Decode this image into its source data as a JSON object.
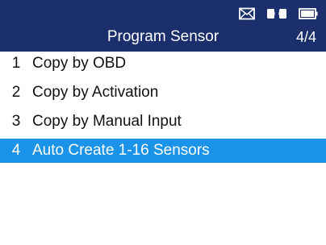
{
  "header": {
    "title": "Program Sensor",
    "page_indicator": "4/4",
    "status_icons": [
      "mail-icon",
      "vci-connection-icon",
      "battery-icon"
    ]
  },
  "menu": {
    "items": [
      {
        "number": "1",
        "label": "Copy by OBD",
        "selected": false
      },
      {
        "number": "2",
        "label": "Copy by Activation",
        "selected": false
      },
      {
        "number": "3",
        "label": "Copy by Manual Input",
        "selected": false
      },
      {
        "number": "4",
        "label": "Auto Create 1-16 Sensors",
        "selected": true
      }
    ]
  },
  "colors": {
    "header_bg": "#1a2f6b",
    "selected_bg": "#1a93e8",
    "text": "#111111",
    "background": "#ffffff"
  }
}
